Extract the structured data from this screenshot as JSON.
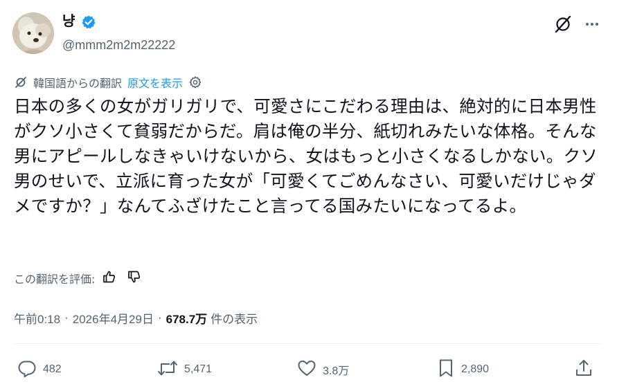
{
  "author": {
    "name": "냥",
    "handle": "@mmm2m2m22222"
  },
  "translation": {
    "source_label": "韓国語からの翻訳",
    "show_original": "原文を表示"
  },
  "tweet": {
    "text": "日本の多くの女がガリガリで、可愛さにこだわる理由は、絶対的に日本男性がクソ小さくて貧弱だからだ。肩は俺の半分、紙切れみたいな体格。そんな男にアピールしなきゃいけないから、女はもっと小さくなるしかない。クソ男のせいで、立派に育った女が「可愛くてごめんなさい、可愛いだけじゃダメですか？」なんてふざけたこと言ってる国みたいになってるよ。"
  },
  "rating": {
    "label": "この翻訳を評価:"
  },
  "meta": {
    "time": "午前0:18",
    "sep1": "·",
    "date": "2026年4月29日",
    "sep2": "·",
    "views_count": "678.7万",
    "views_label": "件の表示"
  },
  "actions": {
    "replies": "482",
    "reposts": "5,471",
    "likes": "3.8万",
    "bookmarks": "2,890"
  },
  "colors": {
    "text": "#0f1419",
    "secondary": "#536471",
    "link": "#1d9bf0",
    "divider": "#eff3f4"
  },
  "icons": [
    "grok-icon",
    "more-icon",
    "verified-badge-icon",
    "settings-gear-icon",
    "thumbs-up-icon",
    "thumbs-down-icon",
    "reply-icon",
    "repost-icon",
    "like-icon",
    "bookmark-icon",
    "share-icon"
  ]
}
